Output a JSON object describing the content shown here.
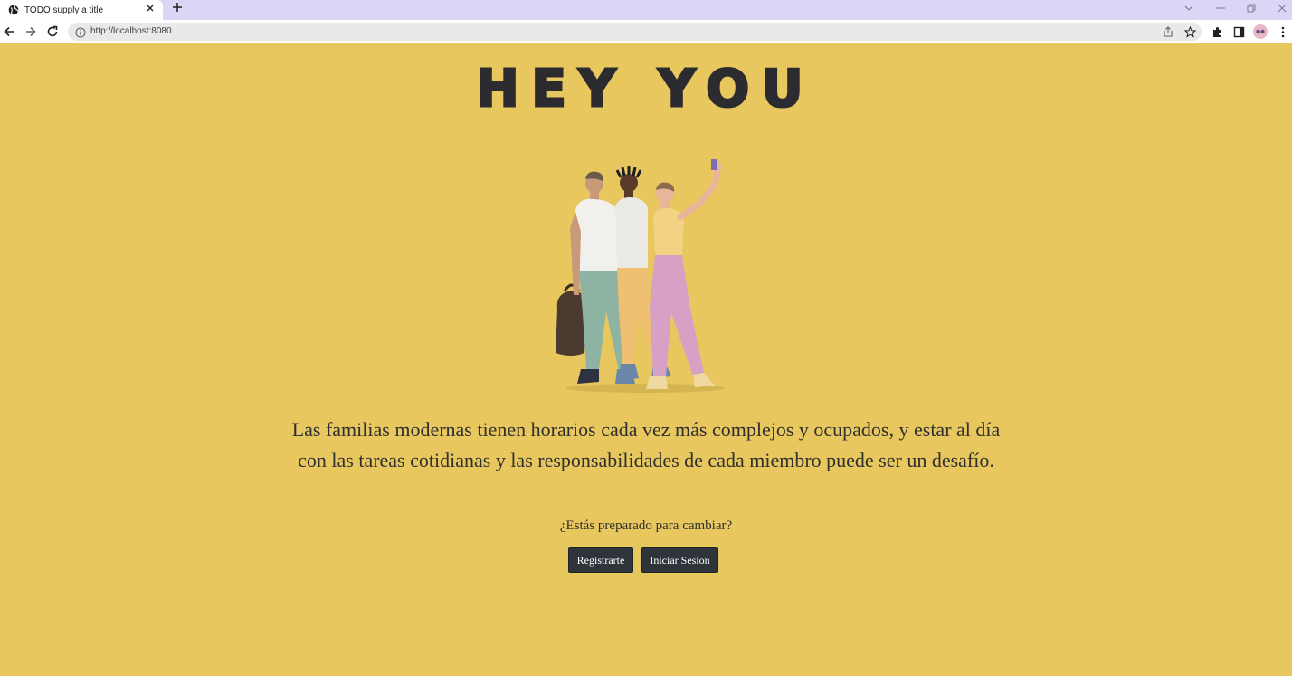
{
  "browser": {
    "tab_title": "TODO supply a title",
    "url": "http://localhost:8080",
    "icons": [
      "globe-icon",
      "close-icon",
      "plus-icon",
      "chevron-down-icon",
      "minimize-icon",
      "restore-icon",
      "window-close-icon",
      "back-arrow-icon",
      "forward-arrow-icon",
      "reload-icon",
      "info-icon",
      "share-icon",
      "star-icon",
      "extensions-icon",
      "side-panel-icon",
      "profile-avatar-icon",
      "more-menu-icon"
    ]
  },
  "page": {
    "title": "HEY YOU",
    "description": "Las familias modernas tienen horarios cada vez más complejos y ocupados, y estar al día con las tareas cotidianas y las responsabilidades de cada miembro puede ser un desafío.",
    "question": "¿Estás preparado para cambiar?",
    "buttons": {
      "register": "Registrarte",
      "login": "Iniciar Sesion"
    }
  },
  "colors": {
    "background": "#e7c75e",
    "button": "#2f333a",
    "title": "#2b2b30",
    "tabbar": "#dcd5f5"
  }
}
